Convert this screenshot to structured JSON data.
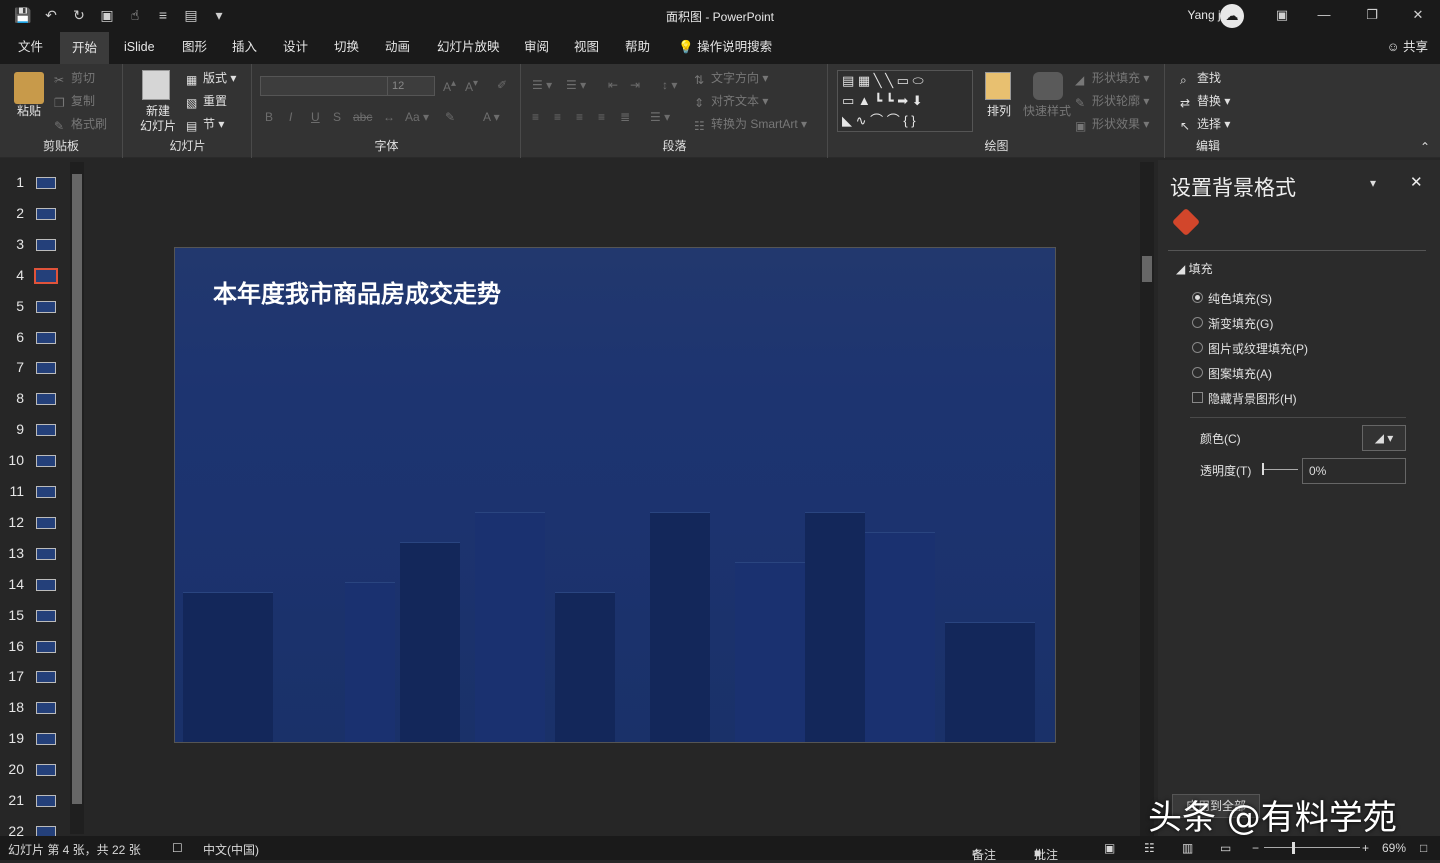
{
  "window": {
    "title": "面积图  -  PowerPoint",
    "user": "Yang jun"
  },
  "menu": {
    "tabs": [
      "文件",
      "开始",
      "iSlide",
      "图形",
      "插入",
      "设计",
      "切换",
      "动画",
      "幻灯片放映",
      "审阅",
      "视图",
      "帮助"
    ],
    "active": "开始",
    "search": "操作说明搜索",
    "share": "共享"
  },
  "ribbon": {
    "clipboard": {
      "label": "剪贴板",
      "paste": "粘贴",
      "cut": "剪切",
      "copy": "复制",
      "format_painter": "格式刷"
    },
    "slides": {
      "label": "幻灯片",
      "new_slide": "新建\n幻灯片",
      "layout": "版式",
      "reset": "重置",
      "section": "节"
    },
    "font": {
      "label": "字体",
      "size": "12"
    },
    "paragraph": {
      "label": "段落",
      "text_direction": "文字方向",
      "align_text": "对齐文本",
      "smartart": "转换为 SmartArt"
    },
    "drawing": {
      "label": "绘图",
      "arrange": "排列",
      "quick_styles": "快速样式",
      "shape_fill": "形状填充",
      "shape_outline": "形状轮廓",
      "shape_effects": "形状效果"
    },
    "editing": {
      "label": "编辑",
      "find": "查找",
      "replace": "替换",
      "select": "选择"
    }
  },
  "thumbnails": {
    "numbers": [
      "1",
      "2",
      "3",
      "4",
      "5",
      "6",
      "7",
      "8",
      "9",
      "10",
      "11",
      "12",
      "13",
      "14",
      "15",
      "16",
      "17",
      "18",
      "19",
      "20",
      "21",
      "22"
    ],
    "selected": 4
  },
  "slide": {
    "title": "本年度我市商品房成交走势"
  },
  "format_pane": {
    "title": "设置背景格式",
    "section": "填充",
    "options": [
      "纯色填充(S)",
      "渐变填充(G)",
      "图片或纹理填充(P)",
      "图案填充(A)"
    ],
    "selected_option": "纯色填充(S)",
    "hide_graphics": "隐藏背景图形(H)",
    "color_label": "颜色(C)",
    "transparency_label": "透明度(T)",
    "transparency_value": "0%",
    "apply_all": "应用到全部"
  },
  "status": {
    "slide_info": "幻灯片 第 4 张，共 22 张",
    "language": "中文(中国)",
    "notes": "备注",
    "comments": "批注",
    "zoom": "69%"
  },
  "watermark": "头条 @有料学苑",
  "colors": {
    "slide_bg": "#1d3470",
    "selected_thumb": "#e0533a",
    "chrome": "#1a1a1a"
  }
}
